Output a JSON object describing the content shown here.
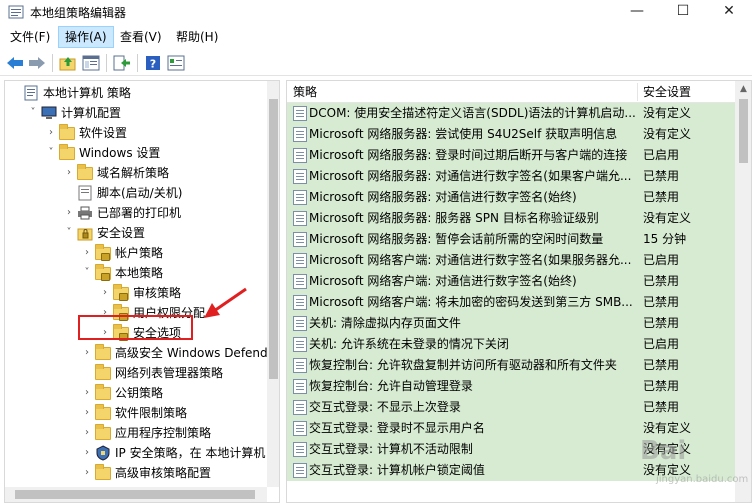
{
  "window": {
    "title": "本地组策略编辑器",
    "controls": {
      "minimize": "—",
      "maximize": "☐",
      "close": "✕"
    }
  },
  "menu": [
    {
      "label": "文件(F)"
    },
    {
      "label": "操作(A)",
      "active": true
    },
    {
      "label": "查看(V)"
    },
    {
      "label": "帮助(H)"
    }
  ],
  "toolbar": [
    "back-icon",
    "forward-icon",
    "up-folder-icon",
    "show-hide-tree-icon",
    "export-list-icon",
    "help-icon",
    "properties-icon"
  ],
  "tree": {
    "items": [
      {
        "label": "本地计算机 策略",
        "level": 0,
        "expander": "",
        "icon": "policy-icon"
      },
      {
        "label": "计算机配置",
        "level": 1,
        "expander": "v",
        "icon": "computer-icon"
      },
      {
        "label": "软件设置",
        "level": 2,
        "expander": ">",
        "icon": "folder-icon"
      },
      {
        "label": "Windows 设置",
        "level": 2,
        "expander": "v",
        "icon": "folder-icon"
      },
      {
        "label": "域名解析策略",
        "level": 3,
        "expander": ">",
        "icon": "folder-icon"
      },
      {
        "label": "脚本(启动/关机)",
        "level": 3,
        "expander": "",
        "icon": "script-icon"
      },
      {
        "label": "已部署的打印机",
        "level": 3,
        "expander": ">",
        "icon": "printer-icon"
      },
      {
        "label": "安全设置",
        "level": 3,
        "expander": "v",
        "icon": "security-icon"
      },
      {
        "label": "帐户策略",
        "level": 4,
        "expander": ">",
        "icon": "lock-folder-icon"
      },
      {
        "label": "本地策略",
        "level": 4,
        "expander": "v",
        "icon": "lock-folder-icon"
      },
      {
        "label": "审核策略",
        "level": 5,
        "expander": ">",
        "icon": "lock-folder-icon"
      },
      {
        "label": "用户权限分配",
        "level": 5,
        "expander": ">",
        "icon": "lock-folder-icon"
      },
      {
        "label": "安全选项",
        "level": 5,
        "expander": ">",
        "icon": "lock-folder-icon",
        "selected": true
      },
      {
        "label": "高级安全 Windows Defende",
        "level": 4,
        "expander": ">",
        "icon": "folder-icon"
      },
      {
        "label": "网络列表管理器策略",
        "level": 4,
        "expander": "",
        "icon": "folder-icon"
      },
      {
        "label": "公钥策略",
        "level": 4,
        "expander": ">",
        "icon": "folder-icon"
      },
      {
        "label": "软件限制策略",
        "level": 4,
        "expander": ">",
        "icon": "folder-icon"
      },
      {
        "label": "应用程序控制策略",
        "level": 4,
        "expander": ">",
        "icon": "folder-icon"
      },
      {
        "label": "IP 安全策略，在 本地计算机",
        "level": 4,
        "expander": ">",
        "icon": "ip-security-icon"
      },
      {
        "label": "高级审核策略配置",
        "level": 4,
        "expander": ">",
        "icon": "folder-icon"
      }
    ]
  },
  "list": {
    "columns": {
      "policy": "策略",
      "setting": "安全设置"
    },
    "rows": [
      {
        "name": "DCOM: 使用安全描述符定义语言(SDDL)语法的计算机启动...",
        "setting": "没有定义"
      },
      {
        "name": "Microsoft 网络服务器: 尝试使用 S4U2Self 获取声明信息",
        "setting": "没有定义"
      },
      {
        "name": "Microsoft 网络服务器: 登录时间过期后断开与客户端的连接",
        "setting": "已启用"
      },
      {
        "name": "Microsoft 网络服务器: 对通信进行数字签名(如果客户端允...",
        "setting": "已禁用"
      },
      {
        "name": "Microsoft 网络服务器: 对通信进行数字签名(始终)",
        "setting": "已禁用"
      },
      {
        "name": "Microsoft 网络服务器: 服务器 SPN 目标名称验证级别",
        "setting": "没有定义"
      },
      {
        "name": "Microsoft 网络服务器: 暂停会话前所需的空闲时间数量",
        "setting": "15 分钟"
      },
      {
        "name": "Microsoft 网络客户端: 对通信进行数字签名(如果服务器允...",
        "setting": "已启用"
      },
      {
        "name": "Microsoft 网络客户端: 对通信进行数字签名(始终)",
        "setting": "已禁用"
      },
      {
        "name": "Microsoft 网络客户端: 将未加密的密码发送到第三方 SMB...",
        "setting": "已禁用"
      },
      {
        "name": "关机: 清除虚拟内存页面文件",
        "setting": "已禁用"
      },
      {
        "name": "关机: 允许系统在未登录的情况下关闭",
        "setting": "已启用"
      },
      {
        "name": "恢复控制台: 允许软盘复制并访问所有驱动器和所有文件夹",
        "setting": "已禁用"
      },
      {
        "name": "恢复控制台: 允许自动管理登录",
        "setting": "已禁用"
      },
      {
        "name": "交互式登录: 不显示上次登录",
        "setting": "已禁用"
      },
      {
        "name": "交互式登录: 登录时不显示用户名",
        "setting": "没有定义"
      },
      {
        "name": "交互式登录: 计算机不活动限制",
        "setting": "没有定义"
      },
      {
        "name": "交互式登录: 计算机帐户锁定阈值",
        "setting": "没有定义"
      }
    ]
  },
  "watermark": {
    "text": "Bai",
    "sub": "jingyan.baidu.com"
  },
  "colors": {
    "row_bg": "#d6ebd1",
    "highlight_box": "#e02020",
    "menu_active": "#cce8ff"
  }
}
